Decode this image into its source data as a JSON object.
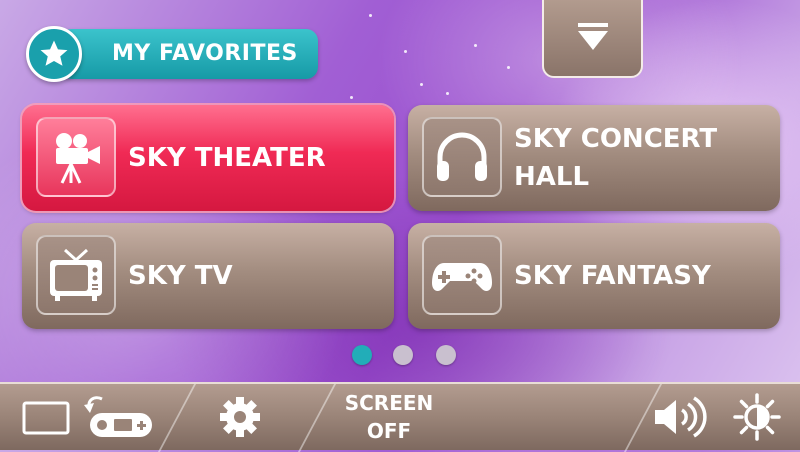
{
  "favorites": {
    "label": "MY FAVORITES"
  },
  "tiles": [
    {
      "label": "SKY THEATER",
      "icon": "movie-camera-icon",
      "selected": true
    },
    {
      "label": "SKY CONCERT HALL",
      "icon": "headphones-icon",
      "selected": false
    },
    {
      "label": "SKY TV",
      "icon": "tv-icon",
      "selected": false
    },
    {
      "label": "SKY FANTASY",
      "icon": "gamepad-icon",
      "selected": false
    }
  ],
  "pagination": {
    "pages": 3,
    "current": 1
  },
  "bottom_bar": {
    "screen_off_line1": "SCREEN",
    "screen_off_line2": "OFF",
    "icons": [
      "switch-device-icon",
      "gear-icon",
      "volume-icon",
      "brightness-icon"
    ]
  },
  "colors": {
    "accent_teal": "#1aa0ac",
    "selected_red": "#f02a55",
    "tile_brown": "#a38d80"
  }
}
